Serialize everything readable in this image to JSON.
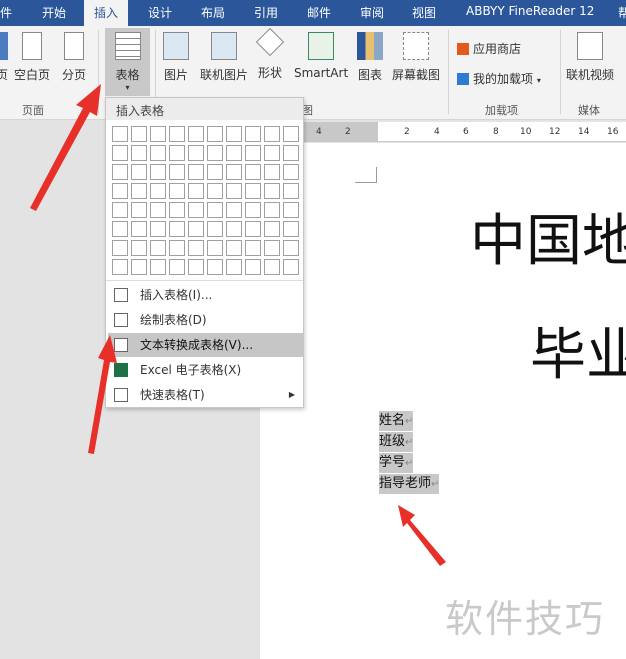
{
  "tabs": [
    "件",
    "开始",
    "插入",
    "设计",
    "布局",
    "引用",
    "邮件",
    "审阅",
    "视图",
    "ABBYY FineReader 12",
    "帮"
  ],
  "ribbon": {
    "page_partial": "页",
    "blank_page": "空白页",
    "page_break": "分页",
    "table": "表格",
    "picture": "图片",
    "online_picture": "联机图片",
    "shapes": "形状",
    "smartart": "SmartArt",
    "chart": "图表",
    "screenshot": "屏幕截图",
    "store": "应用商店",
    "my_addins": "我的加载项",
    "online_video": "联机视频",
    "group_pages": "页面",
    "group_illustrations": "图",
    "group_addins": "加载项",
    "group_media": "媒体"
  },
  "ruler": [
    "4",
    "2",
    "2",
    "4",
    "6",
    "8",
    "10",
    "12",
    "14",
    "16"
  ],
  "menu": {
    "header": "插入表格",
    "rows": 8,
    "cols": 10,
    "items": [
      {
        "label": "插入表格(I)...",
        "icon": "table-icon"
      },
      {
        "label": "绘制表格(D)",
        "icon": "draw-table-icon"
      },
      {
        "label": "文本转换成表格(V)...",
        "icon": "convert-text-icon",
        "highlighted": true
      },
      {
        "label": "Excel 电子表格(X)",
        "icon": "excel-icon"
      },
      {
        "label": "快速表格(T)",
        "icon": "quick-table-icon",
        "submenu": true
      }
    ]
  },
  "document": {
    "title1": "中国地",
    "title2": "毕业",
    "lines": [
      "姓名",
      "班级",
      "学号",
      "指导老师"
    ],
    "para_mark": "↵"
  },
  "watermark": "软件技巧",
  "colors": {
    "accent": "#2b579a",
    "arrow": "#e8302a"
  }
}
